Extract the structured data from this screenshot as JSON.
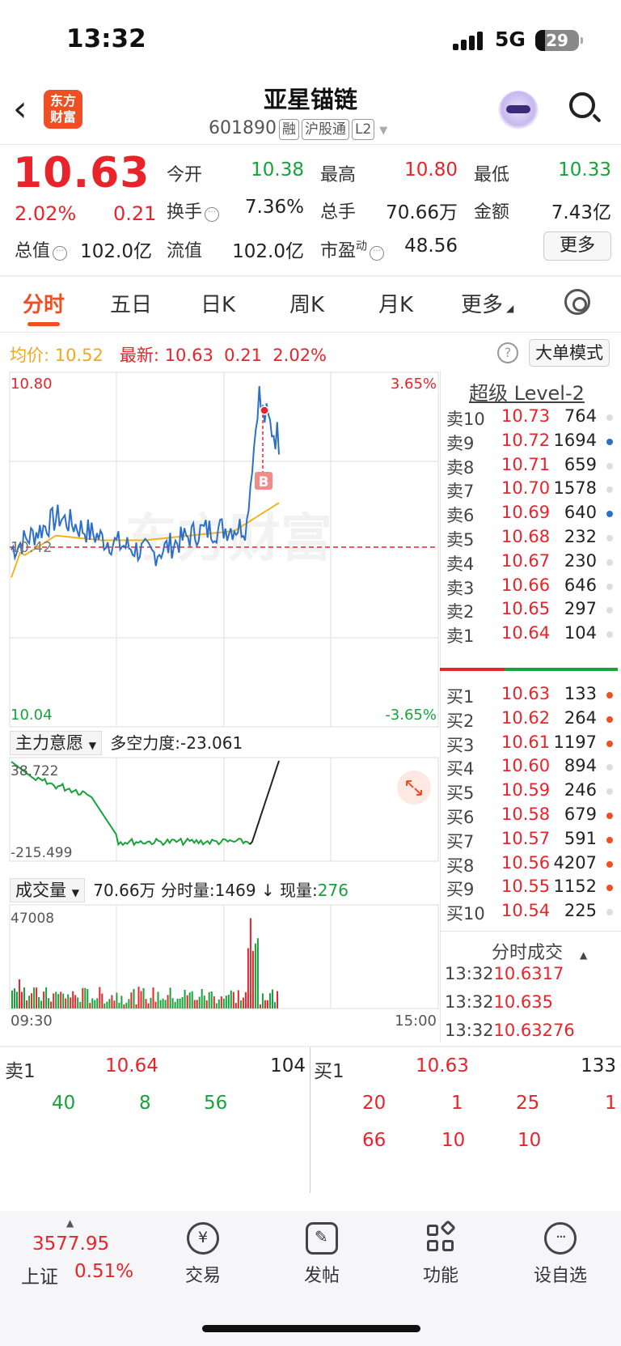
{
  "status_bar": {
    "time": "13:32",
    "network": "5G",
    "battery": "29"
  },
  "header": {
    "logo_text": "东方财富",
    "title": "亚星锚链",
    "code": "601890",
    "tags": [
      "融",
      "沪股通",
      "L2"
    ]
  },
  "quote": {
    "price": "10.63",
    "change_pct": "2.02%",
    "change": "0.21",
    "stats": [
      {
        "label": "今开",
        "value": "10.38",
        "color": "green"
      },
      {
        "label": "最高",
        "value": "10.80",
        "color": "red"
      },
      {
        "label": "最低",
        "value": "10.33",
        "color": "green"
      },
      {
        "label": "换手",
        "value": "7.36%",
        "color": "dark"
      },
      {
        "label": "总手",
        "value": "70.66万",
        "color": "dark"
      },
      {
        "label": "金额",
        "value": "7.43亿",
        "color": "dark"
      },
      {
        "label": "总值",
        "value": "102.0亿",
        "color": "dark"
      },
      {
        "label": "流值",
        "value": "102.0亿",
        "color": "dark"
      },
      {
        "label": "市盈",
        "value": "48.56",
        "color": "dark"
      }
    ],
    "pe_sup": "动",
    "more_label": "更多"
  },
  "tabs": [
    "分时",
    "五日",
    "日K",
    "周K",
    "月K",
    "更多"
  ],
  "avg_row": {
    "avg_label": "均价:",
    "avg_value": "10.52",
    "latest_label": "最新:",
    "latest_value": "10.63",
    "change": "0.21",
    "change_pct": "2.02%",
    "help": "?",
    "big_order_label": "大单模式"
  },
  "main_chart": {
    "y_high": "10.80",
    "y_low": "10.04",
    "pct_high": "3.65%",
    "pct_low": "-3.65%",
    "prev_close_label": "10.42",
    "trade_marker": "B"
  },
  "indicator": {
    "name": "主力意愿",
    "metric_label": "多空力度:",
    "metric_value": "-23.061",
    "top": "38.722",
    "bottom": "-215.499"
  },
  "volume": {
    "name": "成交量",
    "total": "70.66万",
    "period_label": "分时量:",
    "period_value": "1469",
    "arrow": "↓",
    "current_label": "现量:",
    "current_value": "276",
    "max": "47008",
    "time_start": "09:30",
    "time_end": "15:00"
  },
  "chart_data": {
    "type": "line",
    "x": [
      "09:30",
      "10:00",
      "10:30",
      "11:00",
      "11:30/13:00",
      "13:30",
      "14:00",
      "14:30",
      "15:00"
    ],
    "ylim": [
      10.04,
      10.8
    ],
    "reference": 10.42,
    "series": [
      {
        "name": "最新",
        "values": [
          10.42,
          10.49,
          10.44,
          10.41,
          10.46,
          10.47,
          10.63
        ]
      },
      {
        "name": "均价",
        "values": [
          10.39,
          10.45,
          10.44,
          10.44,
          10.45,
          10.46,
          10.52
        ]
      }
    ]
  },
  "level2": {
    "title": "超级 Level-2",
    "asks": [
      {
        "label": "卖10",
        "price": "10.73",
        "vol": "764",
        "dot": "gray"
      },
      {
        "label": "卖9",
        "price": "10.72",
        "vol": "1694",
        "dot": "blue"
      },
      {
        "label": "卖8",
        "price": "10.71",
        "vol": "659",
        "dot": "gray"
      },
      {
        "label": "卖7",
        "price": "10.70",
        "vol": "1578",
        "dot": "gray"
      },
      {
        "label": "卖6",
        "price": "10.69",
        "vol": "640",
        "dot": "blue"
      },
      {
        "label": "卖5",
        "price": "10.68",
        "vol": "232",
        "dot": "gray"
      },
      {
        "label": "卖4",
        "price": "10.67",
        "vol": "230",
        "dot": "gray"
      },
      {
        "label": "卖3",
        "price": "10.66",
        "vol": "646",
        "dot": "gray"
      },
      {
        "label": "卖2",
        "price": "10.65",
        "vol": "297",
        "dot": "gray"
      },
      {
        "label": "卖1",
        "price": "10.64",
        "vol": "104",
        "dot": "gray"
      }
    ],
    "bids": [
      {
        "label": "买1",
        "price": "10.63",
        "vol": "133",
        "dot": "orange"
      },
      {
        "label": "买2",
        "price": "10.62",
        "vol": "264",
        "dot": "orange"
      },
      {
        "label": "买3",
        "price": "10.61",
        "vol": "1197",
        "dot": "orange"
      },
      {
        "label": "买4",
        "price": "10.60",
        "vol": "894",
        "dot": "gray"
      },
      {
        "label": "买5",
        "price": "10.59",
        "vol": "246",
        "dot": "gray"
      },
      {
        "label": "买6",
        "price": "10.58",
        "vol": "679",
        "dot": "orange"
      },
      {
        "label": "买7",
        "price": "10.57",
        "vol": "591",
        "dot": "orange"
      },
      {
        "label": "买8",
        "price": "10.56",
        "vol": "4207",
        "dot": "orange"
      },
      {
        "label": "买9",
        "price": "10.55",
        "vol": "1152",
        "dot": "orange"
      },
      {
        "label": "买10",
        "price": "10.54",
        "vol": "225",
        "dot": "gray"
      }
    ],
    "ticks_title": "分时成交",
    "ticks": [
      {
        "time": "13:32",
        "price": "10.63",
        "vol": "17"
      },
      {
        "time": "13:32",
        "price": "10.63",
        "vol": "5"
      },
      {
        "time": "13:32",
        "price": "10.63",
        "vol": "276"
      }
    ]
  },
  "order_queue": {
    "ask_label": "卖1",
    "ask_price": "10.64",
    "ask_vol": "104",
    "bid_label": "买1",
    "bid_price": "10.63",
    "bid_vol": "133",
    "ask_orders": [
      "40",
      "8",
      "56"
    ],
    "bid_orders": [
      "20",
      "1",
      "25",
      "1",
      "66",
      "10",
      "10"
    ]
  },
  "bottom_nav": {
    "index_value": "3577.95",
    "index_name": "上证",
    "index_pct": "0.51%",
    "items": [
      "交易",
      "发帖",
      "功能",
      "设自选"
    ]
  },
  "colors": {
    "up": "#e8242a",
    "down": "#17a33a",
    "accent": "#f04e23",
    "price_line": "#2d6fc8",
    "avg_line": "#f2b31d"
  }
}
